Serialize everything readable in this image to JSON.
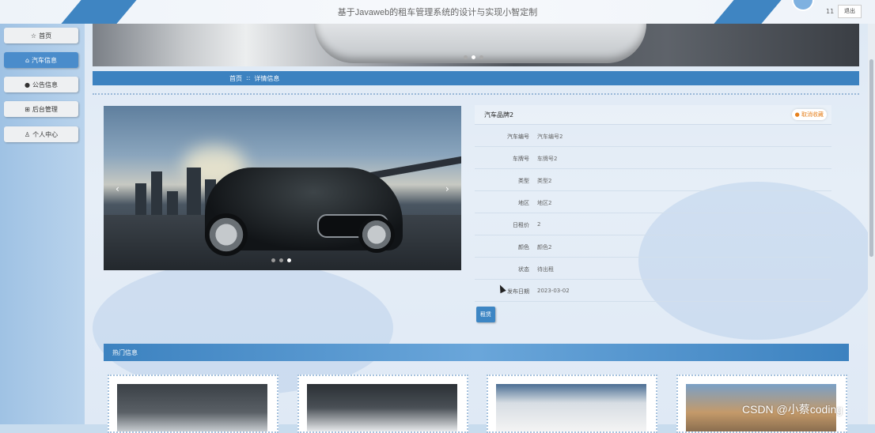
{
  "header": {
    "title": "基于Javaweb的租车管理系统的设计与实现小智定制",
    "user_name": "11",
    "logout_label": "退出"
  },
  "sidebar": {
    "items": [
      {
        "label": "首页",
        "icon": "star-icon"
      },
      {
        "label": "汽车信息",
        "icon": "home-icon",
        "active": true
      },
      {
        "label": "公告信息",
        "icon": "bell-icon"
      },
      {
        "label": "后台管理",
        "icon": "grid-icon"
      },
      {
        "label": "个人中心",
        "icon": "user-icon"
      }
    ]
  },
  "breadcrumb": {
    "home": "首页",
    "separator": "::",
    "current": "详情信息"
  },
  "detail": {
    "brand": "汽车品牌2",
    "fav_label": "取消收藏",
    "fields": [
      {
        "label": "汽车编号",
        "value": "汽车编号2"
      },
      {
        "label": "车牌号",
        "value": "车牌号2"
      },
      {
        "label": "类型",
        "value": "类型2"
      },
      {
        "label": "地区",
        "value": "地区2"
      },
      {
        "label": "日租价",
        "value": "2"
      },
      {
        "label": "颜色",
        "value": "颜色2"
      },
      {
        "label": "状态",
        "value": "待出租"
      },
      {
        "label": "发布日期",
        "value": "2023-03-02"
      }
    ],
    "rent_label": "租赁"
  },
  "hot": {
    "title": "热门信息"
  },
  "watermark": "CSDN @小蔡coding",
  "colors": {
    "accent": "#3c82c0",
    "fav": "#e6811e"
  }
}
